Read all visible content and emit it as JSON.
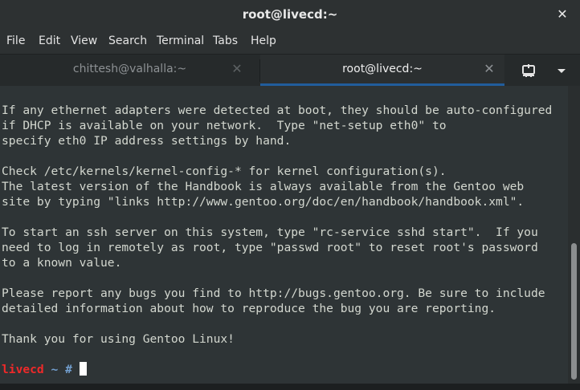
{
  "window": {
    "title": "root@livecd:~",
    "close_glyph": "✕"
  },
  "menu": [
    "File",
    "Edit",
    "View",
    "Search",
    "Terminal",
    "Tabs",
    "Help"
  ],
  "tabs": [
    {
      "label": "chittesh@valhalla:~",
      "active": false,
      "close_glyph": "✕"
    },
    {
      "label": "root@livecd:~",
      "active": true,
      "close_glyph": "✕"
    }
  ],
  "tabbar_icons": {
    "new_tab": "new-tab-icon",
    "menu": "chevron-down-icon"
  },
  "terminal": {
    "lines": [
      "If any ethernet adapters were detected at boot, they should be auto-configured",
      "if DHCP is available on your network.  Type \"net-setup eth0\" to",
      "specify eth0 IP address settings by hand.",
      "",
      "Check /etc/kernels/kernel-config-* for kernel configuration(s).",
      "The latest version of the Handbook is always available from the Gentoo web",
      "site by typing \"links http://www.gentoo.org/doc/en/handbook/handbook.xml\".",
      "",
      "To start an ssh server on this system, type \"rc-service sshd start\".  If you",
      "need to log in remotely as root, type \"passwd root\" to reset root's password",
      "to a known value.",
      "",
      "Please report any bugs you find to http://bugs.gentoo.org. Be sure to include",
      "detailed information about how to reproduce the bug you are reporting.",
      "",
      "Thank you for using Gentoo Linux!"
    ],
    "prompt": {
      "host": "livecd",
      "path": "~",
      "symbol": "#"
    }
  },
  "colors": {
    "terminal_bg": "#2e3436",
    "terminal_fg": "#d3d7cf",
    "prompt_host": "#ef2929",
    "prompt_path": "#729fcf",
    "active_tab_underline": "#215d9c"
  }
}
